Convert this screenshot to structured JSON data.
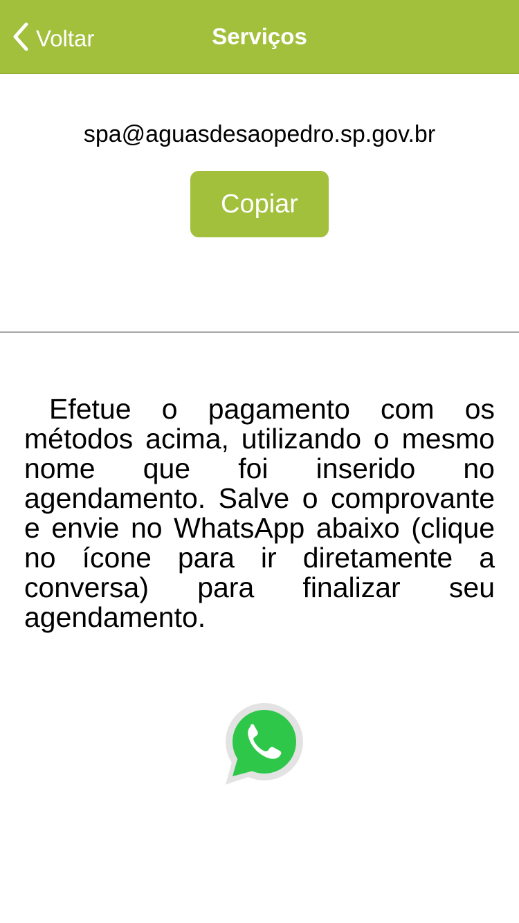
{
  "navbar": {
    "back_label": "Voltar",
    "title": "Serviços"
  },
  "contact": {
    "email": "spa@aguasdesaopedro.sp.gov.br",
    "copy_label": "Copiar"
  },
  "instructions": {
    "text": "Efetue o pagamento com os métodos acima, utilizando o mesmo nome que foi inserido no agendamento. Salve o comprovante e envie no WhatsApp abaixo (clique no ícone para ir diretamente a conversa) para finalizar seu agendamento."
  },
  "whatsapp": {
    "icon": "whatsapp-icon"
  },
  "colors": {
    "brand": "#a2c03c",
    "whatsapp_green": "#2fc74a",
    "divider": "#a6a6a6"
  }
}
